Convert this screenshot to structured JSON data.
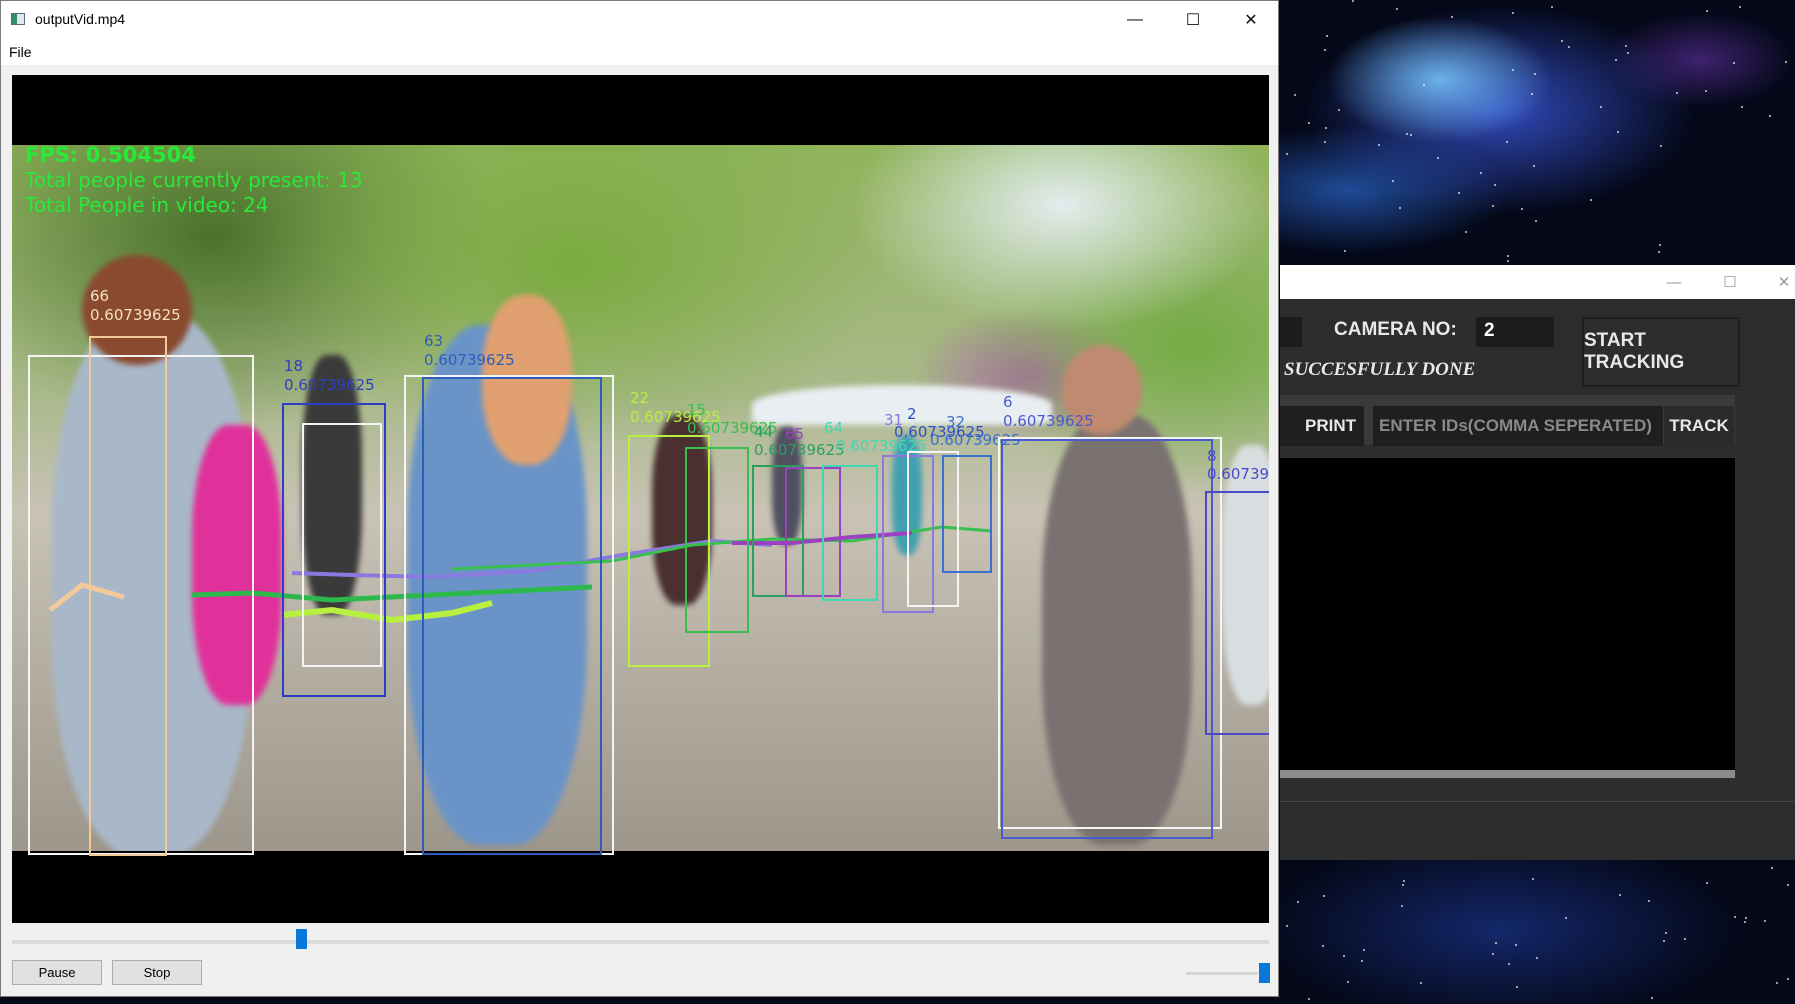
{
  "player": {
    "title": "outputVid.mp4",
    "menu": {
      "file": "File"
    },
    "window_buttons": {
      "minimize": "—",
      "maximize": "☐",
      "close": "✕"
    },
    "overlay": {
      "fps": "FPS: 0.504504",
      "present": "Total people currently present: 13",
      "total": "Total People in video: 24"
    },
    "detections": [
      {
        "id": "66",
        "score": "0.60739625",
        "color": "#f4c99a"
      },
      {
        "id": "18",
        "score": "0.60739625",
        "color": "#2c3fc4"
      },
      {
        "id": "63",
        "score": "0.60739625",
        "color": "#2e5fb8"
      },
      {
        "id": "22",
        "score": "0.60739625",
        "color": "#b8f040"
      },
      {
        "id": "15",
        "score": "0.60739625",
        "color": "#37c050"
      },
      {
        "id": "44",
        "score": "0.60739625",
        "color": "#2aa060"
      },
      {
        "id": "65",
        "score": "",
        "color": "#9a40c0"
      },
      {
        "id": "64",
        "score": "0.60739625",
        "color": "#40d8b0"
      },
      {
        "id": "31",
        "score": "",
        "color": "#8a7ae0"
      },
      {
        "id": "2",
        "score": "0.60739625",
        "color": "#3050c8"
      },
      {
        "id": "32",
        "score": "0.60739625",
        "color": "#3a70d0"
      },
      {
        "id": "6",
        "score": "0.60739625",
        "color": "#4a5ad0"
      },
      {
        "id": "8",
        "score": "0.60739",
        "color": "#4a4ac8"
      }
    ],
    "controls": {
      "pause_label": "Pause",
      "stop_label": "Stop",
      "seek_fraction": 0.23,
      "volume_fraction": 1.0
    },
    "colors": {
      "accent": "#0a78d7",
      "overlay_text": "#29e83a"
    }
  },
  "tracker": {
    "window_buttons": {
      "minimize": "—",
      "maximize": "☐",
      "close": "✕"
    },
    "camera_label": "CAMERA NO:",
    "camera_value": "2",
    "start_button": "START TRACKING",
    "status": "SUCCESFULLY DONE",
    "print_button": "PRINT",
    "ids_placeholder": "ENTER IDs(COMMA SEPERATED)",
    "track_button": "TRACK"
  }
}
